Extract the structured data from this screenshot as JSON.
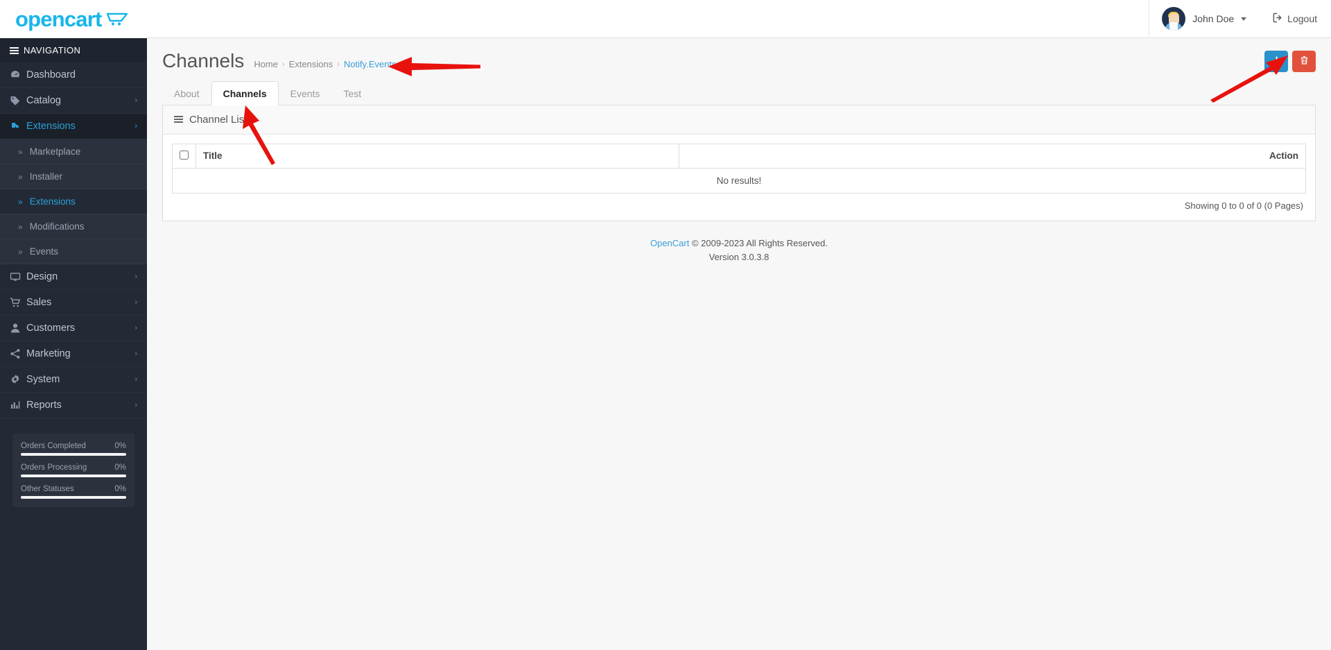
{
  "brand": {
    "name": "opencart",
    "cart_icon": "shopping-cart-icon"
  },
  "sidebar": {
    "nav_header": "NAVIGATION",
    "items": [
      {
        "label": "Dashboard",
        "icon": "dashboard-icon",
        "caret": "",
        "active": false
      },
      {
        "label": "Catalog",
        "icon": "tag-icon",
        "caret": "›",
        "active": false
      },
      {
        "label": "Extensions",
        "icon": "puzzle-icon",
        "caret": "›",
        "active": true
      },
      {
        "label": "Design",
        "icon": "desktop-icon",
        "caret": "›",
        "active": false
      },
      {
        "label": "Sales",
        "icon": "cart-icon",
        "caret": "›",
        "active": false
      },
      {
        "label": "Customers",
        "icon": "user-icon",
        "caret": "›",
        "active": false
      },
      {
        "label": "Marketing",
        "icon": "share-icon",
        "caret": "›",
        "active": false
      },
      {
        "label": "System",
        "icon": "gear-icon",
        "caret": "›",
        "active": false
      },
      {
        "label": "Reports",
        "icon": "chart-bar-icon",
        "caret": "›",
        "active": false
      }
    ],
    "subitems": [
      {
        "label": "Marketplace",
        "active": false
      },
      {
        "label": "Installer",
        "active": false
      },
      {
        "label": "Extensions",
        "active": true
      },
      {
        "label": "Modifications",
        "active": false
      },
      {
        "label": "Events",
        "active": false
      }
    ],
    "stats": [
      {
        "label": "Orders Completed",
        "value": "0%",
        "percent": 0
      },
      {
        "label": "Orders Processing",
        "value": "0%",
        "percent": 0
      },
      {
        "label": "Other Statuses",
        "value": "0%",
        "percent": 0
      }
    ]
  },
  "topbar": {
    "user_name": "John Doe",
    "logout_label": "Logout",
    "logout_icon": "sign-out-icon",
    "avatar": "user-avatar"
  },
  "page": {
    "title": "Channels",
    "breadcrumb": [
      {
        "label": "Home",
        "current": false
      },
      {
        "label": "Extensions",
        "current": false
      },
      {
        "label": "Notify.Events",
        "current": true
      }
    ],
    "breadcrumb_separator": "›",
    "actions": [
      {
        "name": "add-channel-button",
        "icon": "plus-icon",
        "color": "#2b91ca"
      },
      {
        "name": "delete-channel-button",
        "icon": "trash-icon",
        "color": "#e0523d"
      }
    ]
  },
  "tabs": [
    {
      "label": "About",
      "active": false
    },
    {
      "label": "Channels",
      "active": true
    },
    {
      "label": "Events",
      "active": false
    },
    {
      "label": "Test",
      "active": false
    }
  ],
  "panel": {
    "heading": "Channel List",
    "heading_icon": "list-icon",
    "columns": [
      "",
      "Title",
      "Action"
    ],
    "rows": [],
    "empty_text": "No results!",
    "showing": "Showing 0 to 0 of 0 (0 Pages)"
  },
  "footer": {
    "link": "OpenCart",
    "copyright": "© 2009-2023 All Rights Reserved.",
    "version": "Version 3.0.3.8"
  },
  "annotations": {
    "arrow_color": "#e8120d",
    "arrows": [
      {
        "name": "arrow-pointing-breadcrumb",
        "target": "Notify.Events"
      },
      {
        "name": "arrow-pointing-add-button",
        "target": "add-channel-button"
      },
      {
        "name": "arrow-pointing-channels-tab",
        "target": "Channels tab"
      }
    ]
  }
}
